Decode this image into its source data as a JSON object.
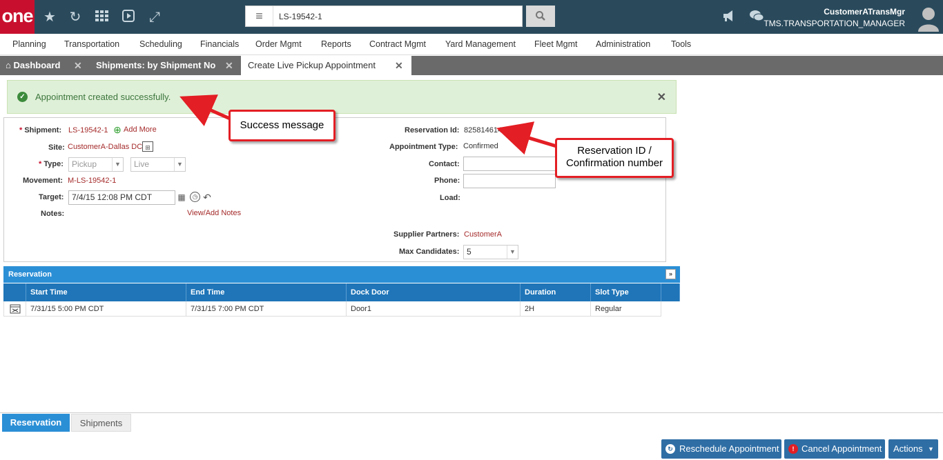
{
  "header": {
    "logo": "one",
    "search_value": "LS-19542-1",
    "user_name": "CustomerATransMgr",
    "user_role": "TMS.TRANSPORTATION_MANAGER"
  },
  "menu": [
    "Planning",
    "Transportation",
    "Scheduling",
    "Financials",
    "Order Mgmt",
    "Reports",
    "Contract Mgmt",
    "Yard Management",
    "Fleet Mgmt",
    "Administration",
    "Tools"
  ],
  "tabs": [
    {
      "label": "Dashboard"
    },
    {
      "label": "Shipments: by Shipment No"
    },
    {
      "label": "Create Live Pickup Appointment"
    }
  ],
  "alert": {
    "text": "Appointment created successfully."
  },
  "form": {
    "shipment_label": "Shipment:",
    "shipment_value": "LS-19542-1",
    "add_more": "Add More",
    "site_label": "Site:",
    "site_value": "CustomerA-Dallas DC",
    "type_label": "Type:",
    "type_value": "Pickup",
    "type2_value": "Live",
    "movement_label": "Movement:",
    "movement_value": "M-LS-19542-1",
    "target_label": "Target:",
    "target_value": "7/4/15 12:08 PM CDT",
    "notes_label": "Notes:",
    "notes_link": "View/Add Notes",
    "reservation_id_label": "Reservation Id:",
    "reservation_id_value": "825814614",
    "appointment_type_label": "Appointment Type:",
    "appointment_type_value": "Confirmed",
    "contact_label": "Contact:",
    "phone_label": "Phone:",
    "load_label": "Load:",
    "supplier_partners_label": "Supplier Partners:",
    "supplier_partners_value": "CustomerA",
    "max_candidates_label": "Max Candidates:",
    "max_candidates_value": "5"
  },
  "callouts": {
    "success": "Success message",
    "reservation": "Reservation ID / Confirmation number"
  },
  "reservation_grid": {
    "title": "Reservation",
    "columns": [
      "Start Time",
      "End Time",
      "Dock Door",
      "Duration",
      "Slot Type"
    ],
    "rows": [
      [
        "7/31/15 5:00 PM CDT",
        "7/31/15 7:00 PM CDT",
        "Door1",
        "2H",
        "Regular"
      ]
    ]
  },
  "bottom_tabs": [
    "Reservation",
    "Shipments"
  ],
  "buttons": {
    "reschedule": "Reschedule Appointment",
    "cancel": "Cancel Appointment",
    "actions": "Actions"
  },
  "colors": {
    "header_bg": "#2a4a5c",
    "brand_red": "#c8102e",
    "grid_blue": "#2b8fd6",
    "button_blue": "#2f6ea5",
    "success_bg": "#dff0d8"
  }
}
